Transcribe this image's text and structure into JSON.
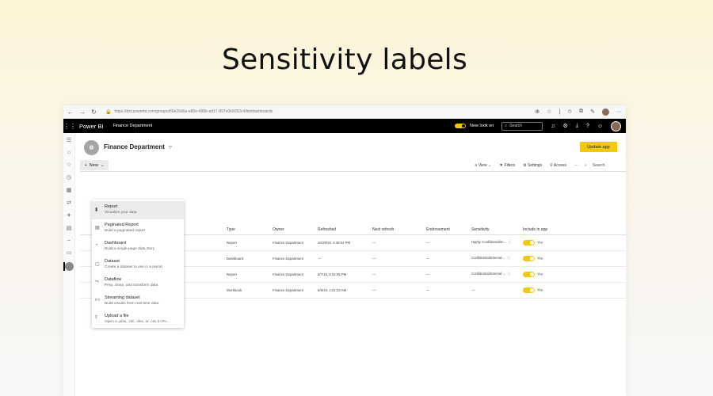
{
  "slide_title": "Sensitivity labels",
  "browser": {
    "url": "https://dxt.powerbi.com/groups/80e26d0a-e85e-498b-ad17-897e0b9052c4/list/dashboards"
  },
  "topbar": {
    "brand": "Power BI",
    "workspace": "Finance Department",
    "new_look_label": "New look on",
    "search_placeholder": "Search"
  },
  "header": {
    "title": "Finance Department",
    "update_label": "Update app"
  },
  "cmdbar": {
    "new_label": "New",
    "view_label": "View",
    "filters_label": "Filters",
    "settings_label": "Settings",
    "access_label": "Access",
    "more": "···",
    "search_placeholder": "Search"
  },
  "new_menu": [
    {
      "title": "Report",
      "desc": "Visualize your data",
      "icon": "bar-chart-icon"
    },
    {
      "title": "Paginated Report",
      "desc": "Build a paginated report",
      "icon": "paginated-report-icon"
    },
    {
      "title": "Dashboard",
      "desc": "Build a single-page data story",
      "icon": "dashboard-icon"
    },
    {
      "title": "Dataset",
      "desc": "Create a dataset to use in a report",
      "icon": "dataset-icon"
    },
    {
      "title": "Dataflow",
      "desc": "Prep, clean, and transform data",
      "icon": "dataflow-icon"
    },
    {
      "title": "Streaming dataset",
      "desc": "Build visuals from real-time data",
      "icon": "streaming-icon"
    },
    {
      "title": "Upload a file",
      "desc": "Open a .pbix, .rdl, .xlsx, or .csv in Po...",
      "icon": "upload-icon"
    }
  ],
  "table": {
    "columns": [
      "Type",
      "Owner",
      "Refreshed",
      "Next refresh",
      "Endorsement",
      "Sensitivity",
      "Include in app"
    ],
    "rows": [
      {
        "type": "Report",
        "owner": "Finance Department",
        "refreshed": "10/29/19, 3:48:04 PM",
        "next": "—",
        "endorsement": "—",
        "sensitivity": "Highly Confidential\\In...",
        "include": "Yes"
      },
      {
        "type": "Dashboard",
        "owner": "Finance Department",
        "refreshed": "—",
        "next": "—",
        "endorsement": "—",
        "sensitivity": "Confidential\\Internal-...",
        "include": "Yes"
      },
      {
        "type": "Report",
        "owner": "Finance Department",
        "refreshed": "6/7/19, 6:02:05 PM",
        "next": "—",
        "endorsement": "—",
        "sensitivity": "Confidential\\Internal-...",
        "include": "Yes"
      },
      {
        "type": "Workbook",
        "owner": "Finance Department",
        "refreshed": "6/5/19, 2:21:23 AM",
        "next": "—",
        "endorsement": "—",
        "sensitivity": "—",
        "include": "Yes"
      }
    ]
  },
  "colors": {
    "accent": "#f2c811",
    "topbar": "#000000"
  }
}
